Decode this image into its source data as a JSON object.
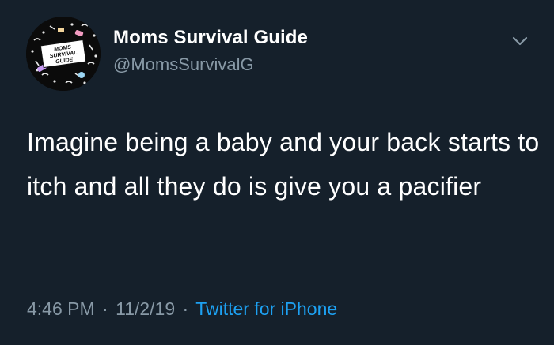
{
  "author": {
    "display_name": "Moms Survival Guide",
    "handle": "@MomsSurvivalG",
    "avatar_text": "MOMS SURVIVAL GUIDE"
  },
  "tweet": {
    "text": "Imagine being a baby and your back starts to itch and all they do is give you a pacifier",
    "time": "4:46 PM",
    "date": "11/2/19",
    "separator": "·",
    "source": "Twitter for iPhone"
  },
  "icons": {
    "menu": "chevron-down-icon"
  },
  "colors": {
    "background": "#15202b",
    "primary_text": "#ffffff",
    "secondary_text": "#8899a6",
    "link": "#1da1f2"
  }
}
